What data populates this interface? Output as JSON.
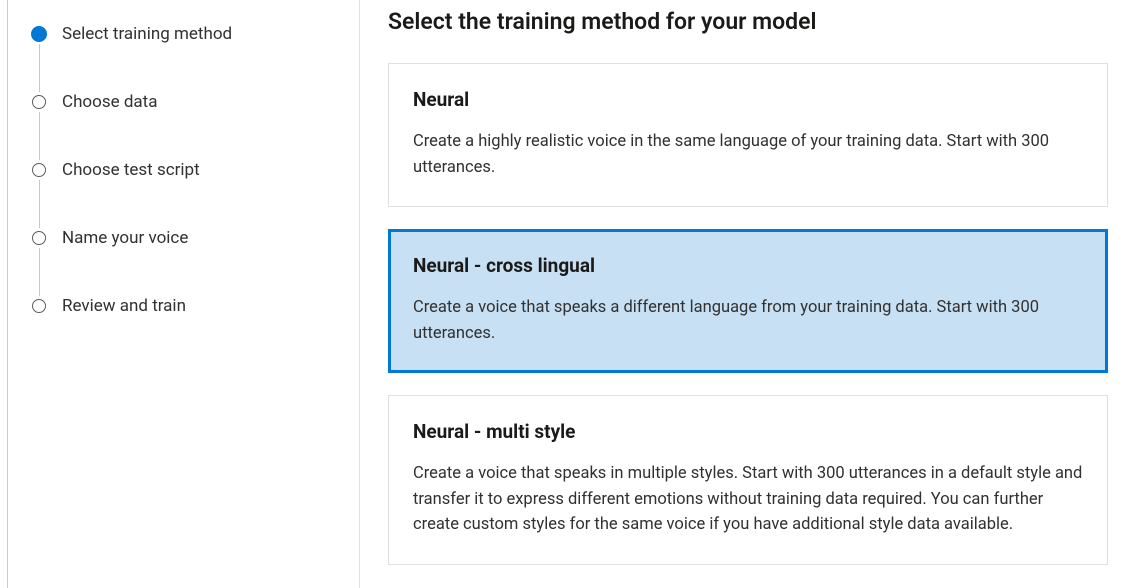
{
  "sidebar": {
    "steps": [
      {
        "label": "Select training method",
        "active": true
      },
      {
        "label": "Choose data",
        "active": false
      },
      {
        "label": "Choose test script",
        "active": false
      },
      {
        "label": "Name your voice",
        "active": false
      },
      {
        "label": "Review and train",
        "active": false
      }
    ]
  },
  "main": {
    "title": "Select the training method for your model",
    "cards": [
      {
        "title": "Neural",
        "desc": "Create a highly realistic voice in the same language of your training data. Start with 300 utterances.",
        "selected": false
      },
      {
        "title": "Neural - cross lingual",
        "desc": "Create a voice that speaks a different language from your training data. Start with 300 utterances.",
        "selected": true
      },
      {
        "title": "Neural - multi style",
        "desc": "Create a voice that speaks in multiple styles. Start with 300 utterances in a default style and transfer it to express different emotions without training data required. You can further create custom styles for the same voice if you have additional style data available.",
        "selected": false
      }
    ]
  }
}
